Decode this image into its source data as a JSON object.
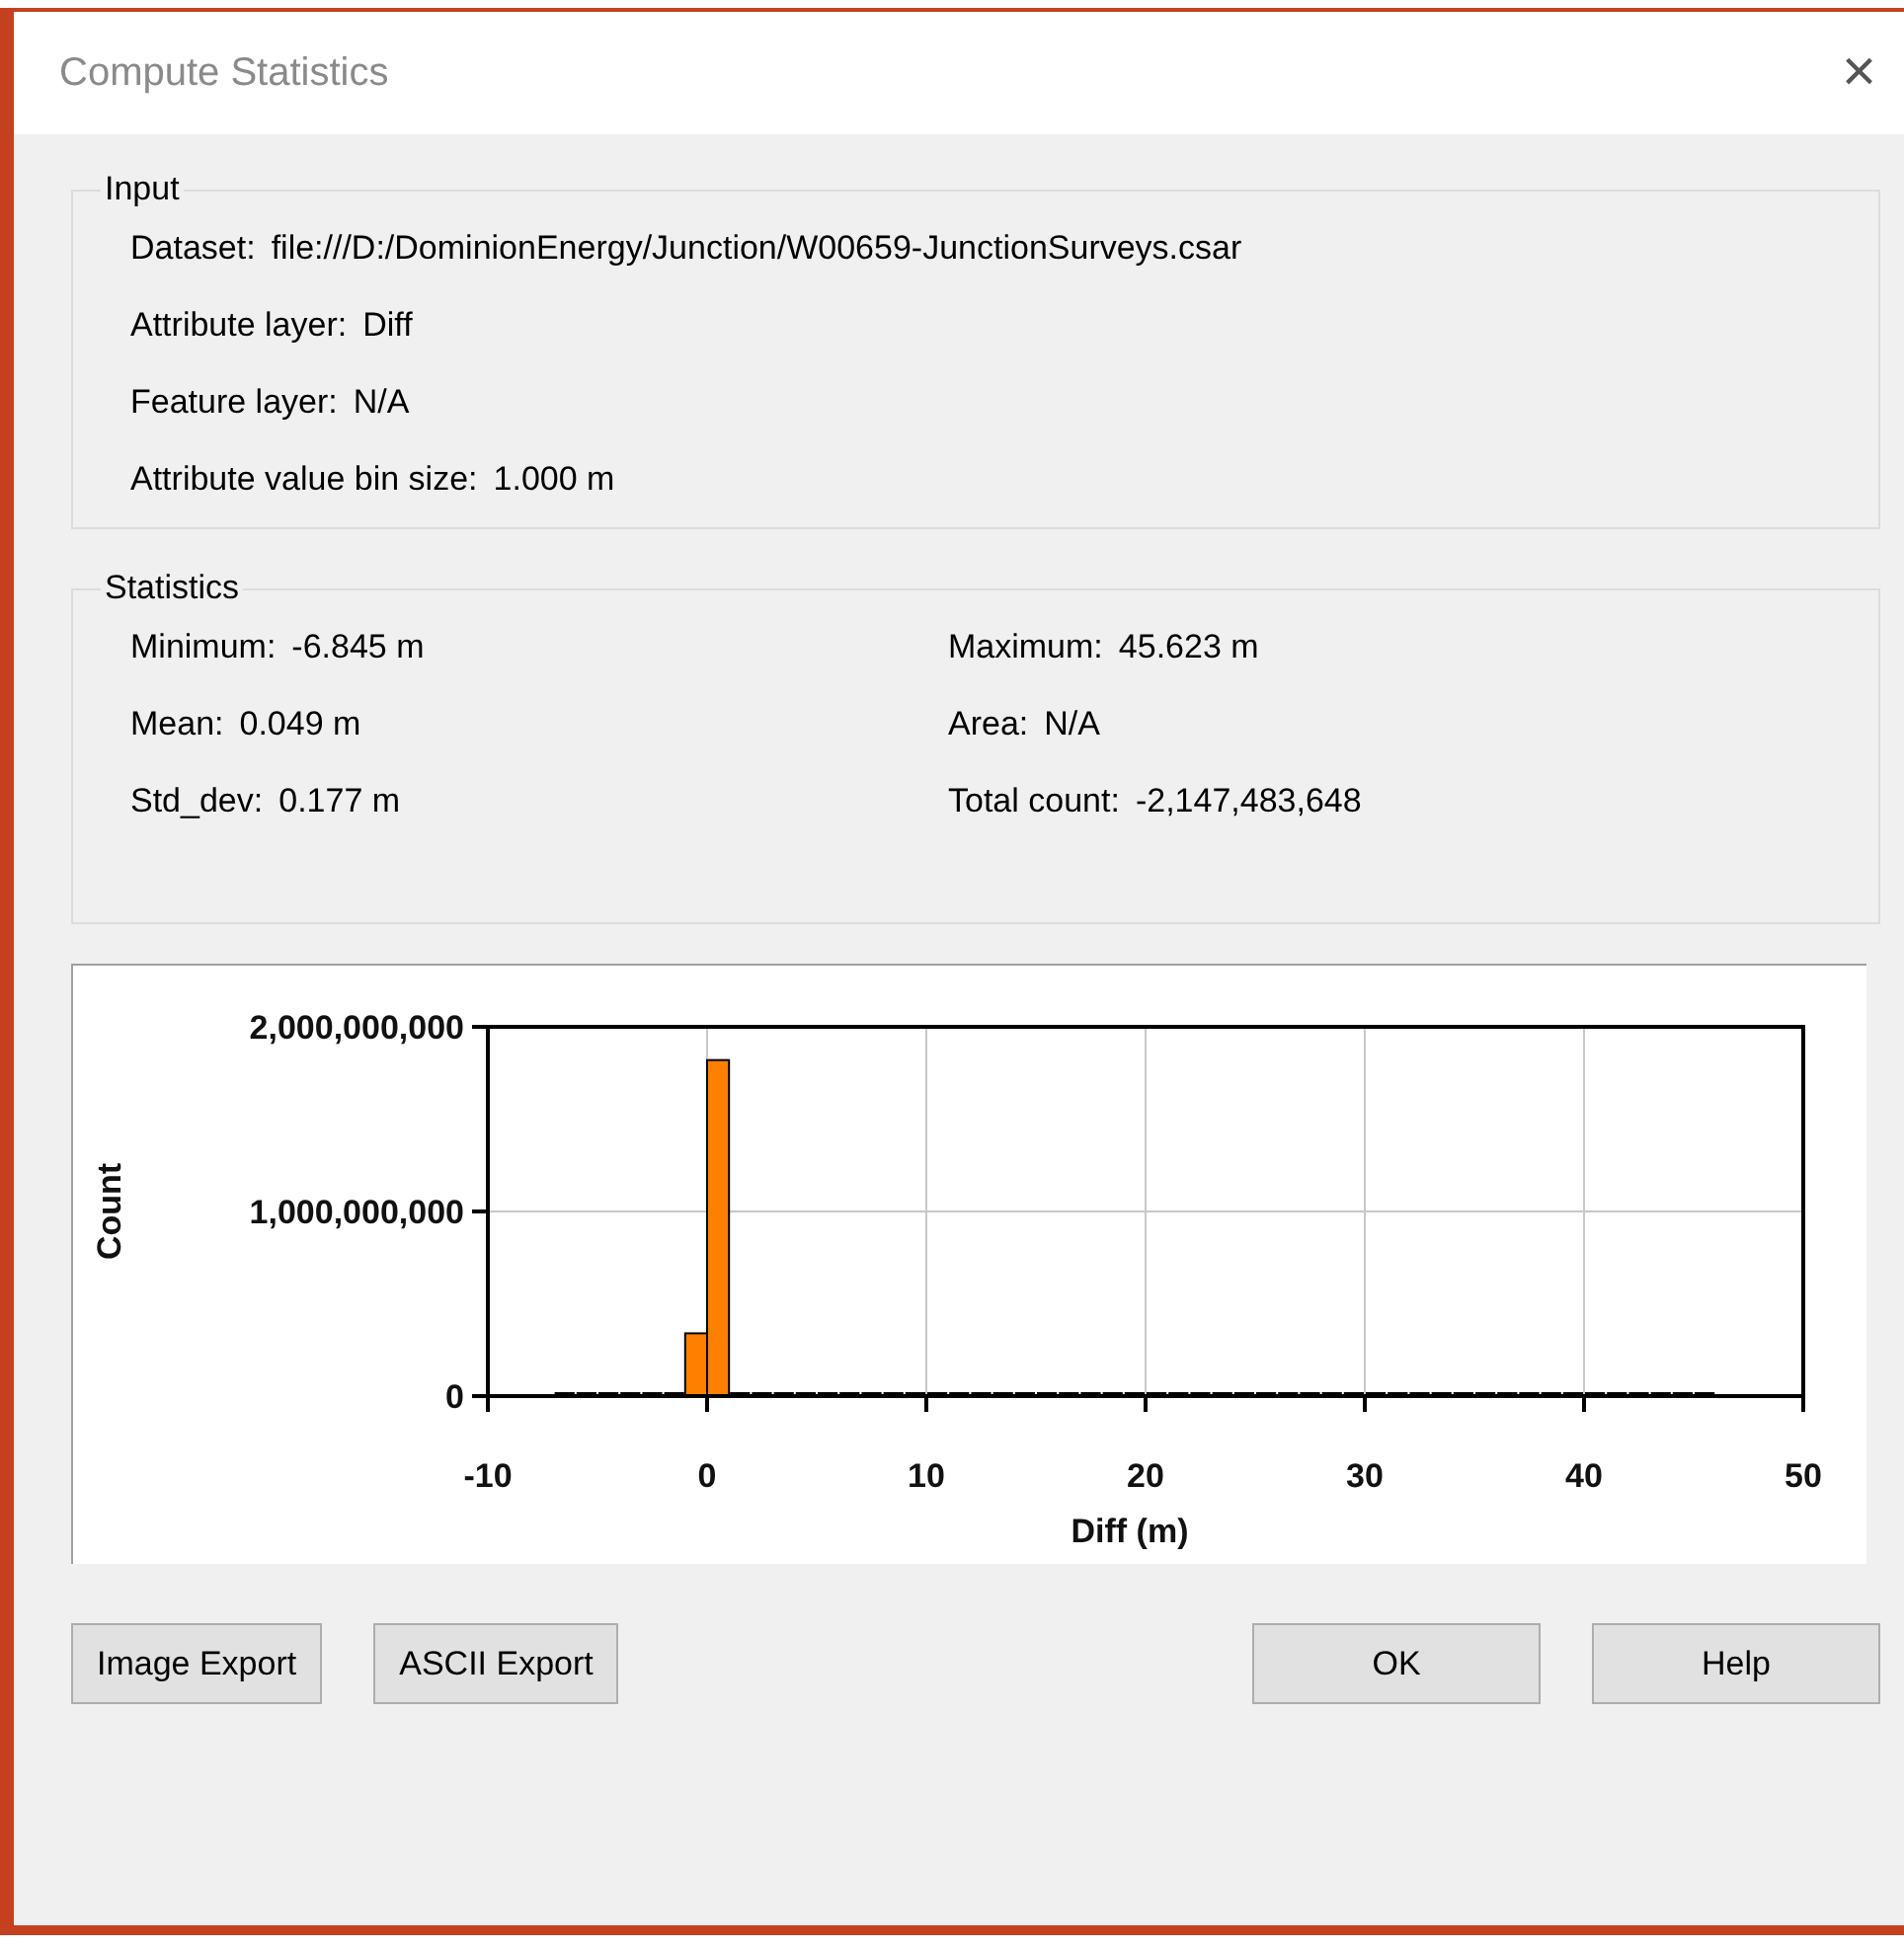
{
  "window": {
    "title": "Compute Statistics",
    "close": "×"
  },
  "input": {
    "legend": "Input",
    "rows": [
      {
        "label": "Dataset:",
        "value": "file:///D:/DominionEnergy/Junction/W00659-JunctionSurveys.csar"
      },
      {
        "label": "Attribute layer:",
        "value": "Diff"
      },
      {
        "label": "Feature layer:",
        "value": "N/A"
      },
      {
        "label": "Attribute value bin size:",
        "value": "1.000 m"
      }
    ]
  },
  "statistics": {
    "legend": "Statistics",
    "rows": [
      {
        "label": "Minimum:",
        "value": "-6.845 m"
      },
      {
        "label": "Maximum:",
        "value": "45.623 m"
      },
      {
        "label": "Mean:",
        "value": "0.049 m"
      },
      {
        "label": "Area:",
        "value": "N/A"
      },
      {
        "label": "Std_dev:",
        "value": "0.177 m"
      },
      {
        "label": "Total count:",
        "value": "-2,147,483,648"
      }
    ]
  },
  "histogram": {
    "chart_data": {
      "type": "bar",
      "xlabel": "Diff (m)",
      "ylabel": "Count",
      "x": [
        -6.5,
        -5.5,
        -4.5,
        -3.5,
        -2.5,
        -1.5,
        -0.5,
        0.5,
        1.5,
        2.5,
        3.5,
        4.5,
        5.5,
        6.5,
        7.5,
        8.5,
        9.5,
        10.5,
        11.5,
        12.5,
        13.5,
        14.5,
        15.5,
        16.5,
        17.5,
        18.5,
        19.5,
        20.5,
        21.5,
        22.5,
        23.5,
        24.5,
        25.5,
        26.5,
        27.5,
        28.5,
        29.5,
        30.5,
        31.5,
        32.5,
        33.5,
        34.5,
        35.5,
        36.5,
        37.5,
        38.5,
        39.5,
        40.5,
        41.5,
        42.5,
        43.5,
        44.5,
        45.5
      ],
      "grid": true,
      "values": [
        0,
        0,
        0,
        0,
        0,
        0,
        340000000,
        1820000000,
        0,
        0,
        0,
        0,
        0,
        0,
        0,
        0,
        0,
        0,
        0,
        0,
        0,
        0,
        0,
        0,
        0,
        0,
        0,
        0,
        0,
        0,
        0,
        0,
        0,
        0,
        0,
        0,
        0,
        0,
        0,
        0,
        0,
        0,
        0,
        0,
        0,
        0,
        0,
        0,
        0,
        0,
        0,
        0,
        0
      ],
      "xlim": [
        -10,
        50
      ],
      "ylim": [
        0,
        2000000000
      ],
      "xticks": [
        -10,
        0,
        10,
        20,
        30,
        40,
        50
      ],
      "yticks": [
        {
          "value": 0,
          "label": "0"
        },
        {
          "value": 1000000000,
          "label": "1,000,000,000"
        },
        {
          "value": 2000000000,
          "label": "2,000,000,000"
        }
      ]
    }
  },
  "buttons": [
    {
      "label": "Image Export",
      "kind": "export"
    },
    {
      "label": "ASCII Export",
      "kind": "export"
    },
    {
      "label": "OK",
      "kind": "dialog"
    },
    {
      "label": "Help",
      "kind": "dialog"
    }
  ]
}
